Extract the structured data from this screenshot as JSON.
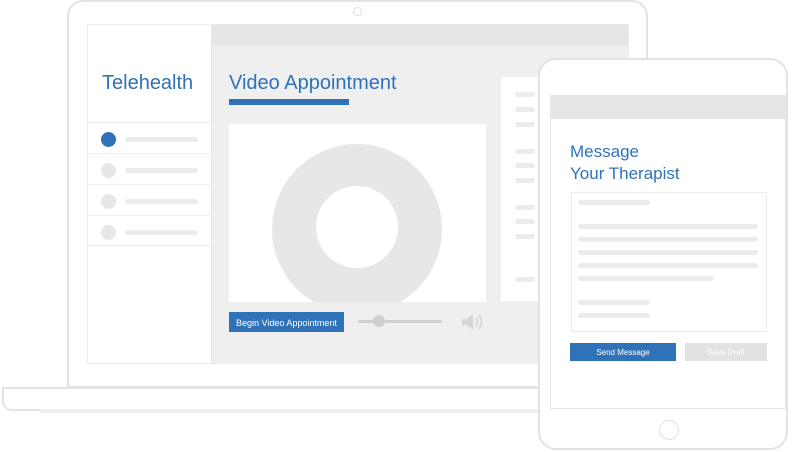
{
  "laptop": {
    "sidebar": {
      "app_title": "Telehealth",
      "items": [
        {
          "active": true
        },
        {
          "active": false
        },
        {
          "active": false
        },
        {
          "active": false
        }
      ]
    },
    "main": {
      "title": "Video Appointment",
      "begin_button_label": "Begin Video Appointment",
      "volume_level": 0.25
    }
  },
  "tablet": {
    "title_line1": "Message",
    "title_line2": "Your Therapist",
    "send_button_label": "Send Message",
    "save_draft_label": "Save Draft"
  },
  "colors": {
    "accent": "#2f72b8",
    "placeholder": "#ececec",
    "disabled_button": "#e2e2e2"
  },
  "icons": [
    "speaker-icon",
    "camera-dot-icon",
    "home-button-icon"
  ]
}
